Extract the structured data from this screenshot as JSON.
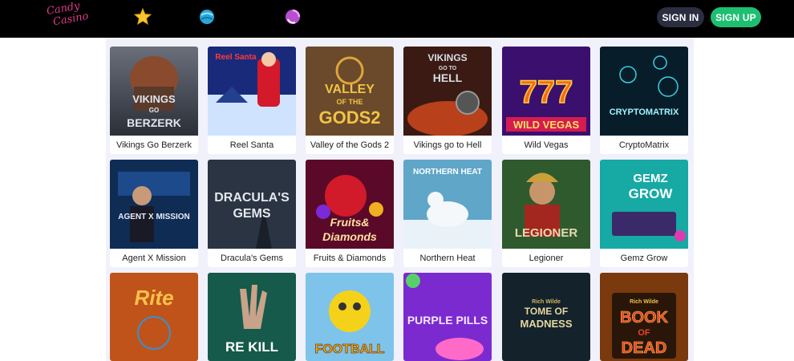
{
  "header": {
    "logo_line1": "Candy",
    "logo_line2": "Casino",
    "nav_icons": [
      "star-icon",
      "candy-ball-icon",
      "lollipop-icon"
    ],
    "signin_label": "SIGN IN",
    "signup_label": "SIGN UP",
    "colors": {
      "bar": "#000000",
      "signin": "#2b2d40",
      "signup": "#1dbf71",
      "logo": "#e23a8a"
    }
  },
  "games": [
    {
      "name": "Vikings Go Berzerk",
      "art_lines": [
        "VIKINGS",
        "GO",
        "BERZERK"
      ]
    },
    {
      "name": "Reel Santa",
      "art_lines": [
        "Reel Santa"
      ]
    },
    {
      "name": "Valley of the Gods 2",
      "art_lines": [
        "VALLEY",
        "OF THE",
        "GODS2"
      ]
    },
    {
      "name": "Vikings go to Hell",
      "art_lines": [
        "VIKINGS",
        "GO TO",
        "HELL"
      ]
    },
    {
      "name": "Wild Vegas",
      "art_lines": [
        "777",
        "WILD VEGAS"
      ]
    },
    {
      "name": "CryptoMatrix",
      "art_lines": [
        "CRYPTOMATRIX"
      ]
    },
    {
      "name": "Agent X Mission",
      "art_lines": [
        "AGENT X MISSION"
      ]
    },
    {
      "name": "Dracula's Gems",
      "art_lines": [
        "DRACULA'S",
        "GEMS"
      ]
    },
    {
      "name": "Fruits & Diamonds",
      "art_lines": [
        "Fruits&",
        "Diamonds"
      ]
    },
    {
      "name": "Northern Heat",
      "art_lines": [
        "NORTHERN HEAT"
      ]
    },
    {
      "name": "Legioner",
      "art_lines": [
        "LEGIONER"
      ]
    },
    {
      "name": "Gemz Grow",
      "art_lines": [
        "GEMZ",
        "GROW"
      ]
    },
    {
      "name": "",
      "art_lines": [
        "Rite"
      ]
    },
    {
      "name": "",
      "art_lines": [
        "RE KILL"
      ]
    },
    {
      "name": "",
      "art_lines": [
        "FOOTBALL"
      ]
    },
    {
      "name": "",
      "art_lines": [
        "PURPLE PILLS"
      ]
    },
    {
      "name": "",
      "art_lines": [
        "Rich Wilde",
        "TOME OF",
        "MADNESS"
      ]
    },
    {
      "name": "",
      "art_lines": [
        "Rich Wilde",
        "BOOK",
        "OF",
        "DEAD"
      ]
    }
  ]
}
